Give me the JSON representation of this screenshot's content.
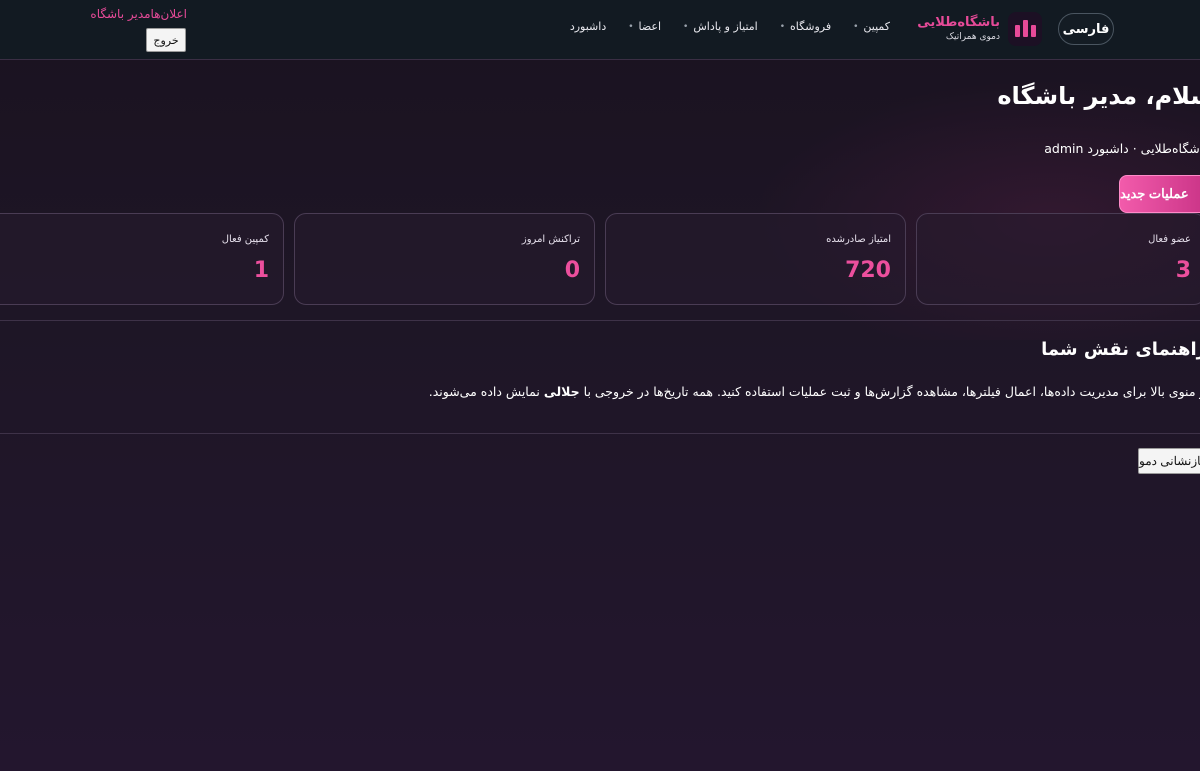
{
  "header": {
    "lang_button": "فارسی",
    "brand": {
      "name": "باشگاه‌طلایی",
      "subtitle": "دموی همراتیک"
    },
    "nav": [
      {
        "label": "داشبورد",
        "has_dropdown": false
      },
      {
        "label": "اعضا",
        "has_dropdown": true
      },
      {
        "label": "امتیاز و پاداش",
        "has_dropdown": true
      },
      {
        "label": "فروشگاه",
        "has_dropdown": true
      },
      {
        "label": "کمپین",
        "has_dropdown": true
      }
    ],
    "dropdown_marker": "•",
    "notifications_user": "اعلان‌هامدیر باشگاه",
    "logout": "خروج"
  },
  "main": {
    "greeting": "سلام، مدیر باشگاه",
    "breadcrumb": "باشگاه‌طلایی · داشبورد admin",
    "new_operation": "عملیات جدید",
    "stats": [
      {
        "label": "عضو فعال",
        "value": "3"
      },
      {
        "label": "امتیاز صادرشده",
        "value": "720"
      },
      {
        "label": "تراکنش امروز",
        "value": "0"
      },
      {
        "label": "کمپین فعال",
        "value": "1"
      }
    ],
    "guide": {
      "title": "راهنمای نقش شما",
      "text_before": "از منوی بالا برای مدیریت داده‌ها، اعمال فیلترها، مشاهده گزارش‌ها و ثبت عملیات استفاده کنید. همه تاریخ‌ها در خروجی با ",
      "text_bold": "جلالی",
      "text_after": " نمایش داده می‌شوند."
    },
    "reset_demo": "بازنشانی دمو"
  },
  "colors": {
    "accent": "#e64a98",
    "header_bg": "#121a22",
    "page_bg": "#1e1626"
  }
}
